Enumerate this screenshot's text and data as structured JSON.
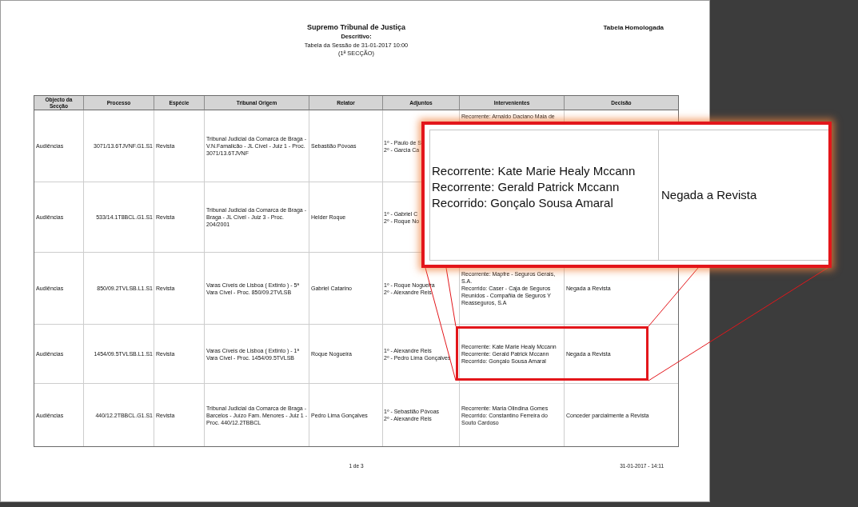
{
  "document": {
    "court": "Supremo Tribunal de Justiça",
    "heading": "Descritivo:",
    "session": "Tabela da Sessão de 31-01-2017 10:00",
    "section": "(1ª SECÇÃO)",
    "status": "Tabela Homologada"
  },
  "table": {
    "columns": [
      "Objecto da Secção",
      "Processo",
      "Espécie",
      "Tribunal Origem",
      "Relator",
      "Adjuntos",
      "Intervenientes",
      "Decisão"
    ],
    "rows": [
      {
        "objecto": "Audiências",
        "processo": "3071/13.6TJVNF.G1.S1",
        "especie": "Revista",
        "tribunal_origem": "Tribunal Judicial da Comarca de Braga - V.N.Famalicão - JL Cível - Juiz 1 - Proc. 3071/13.6TJVNF",
        "relator": "Sebastião Póvoas",
        "adjuntos": [
          "1º - Paulo de S",
          "2º - Garcia Ca"
        ],
        "intervenientes": [
          "Recorrente: Arnaldo Daciano Maia de"
        ],
        "highlighted": false
      },
      {
        "objecto": "Audiências",
        "processo": "533/14.1T8BCL.G1.S1",
        "especie": "Revista",
        "tribunal_origem": "Tribunal Judicial da Comarca de Braga - Braga - JL Cível - Juiz 3 - Proc. 204/2001",
        "relator": "Helder Roque",
        "adjuntos": [
          "1º - Gabriel C",
          "2º - Roque No"
        ],
        "highlighted": false
      },
      {
        "objecto": "Audiências",
        "processo": "850/09.2TVLSB.L1.S1",
        "especie": "Revista",
        "tribunal_origem": "Varas Cíveis de Lisboa ( Extinto ) - 5ª Vara Cível - Proc. 850/09.2TVLSB",
        "relator": "Gabriel Catarino",
        "adjuntos": [
          "1º - Roque Nogueira",
          "2º - Alexandre Reis"
        ],
        "intervenientes": [
          "Recorrente: Mapfre - Seguros Gerais, S.A.",
          "Recorrido: Caser - Caja de Seguros Reunidos - Compañia de Seguros Y Reasseguros, S.A"
        ],
        "decisao": "Negada a Revista",
        "highlighted": false
      },
      {
        "objecto": "Audiências",
        "processo": "1454/09.5TVLSB.L1.S1",
        "especie": "Revista",
        "tribunal_origem": "Varas Cíveis de Lisboa ( Extinto ) - 1ª Vara Cível - Proc. 1454/09.5TVLSB",
        "relator": "Roque Nogueira",
        "adjuntos": [
          "1º - Alexandre Reis",
          "2º - Pedro Lima Gonçalves"
        ],
        "intervenientes": [
          "Recorrente: Kate Marie Healy Mccann",
          "Recorrente: Gerald Patrick Mccann",
          "Recorrido: Gonçalo Sousa Amaral"
        ],
        "decisao": "Negada a Revista",
        "highlighted": true
      },
      {
        "objecto": "Audiências",
        "processo": "440/12.2TBBCL.G1.S1",
        "especie": "Revista",
        "tribunal_origem": "Tribunal Judicial da Comarca de Braga - Barcelos - Juízo Fam. Menores - Juiz 1 - Proc. 440/12.2TBBCL",
        "relator": "Pedro Lima Gonçalves",
        "adjuntos": [
          "1º - Sebastião Póvoas",
          "2º - Alexandre Reis"
        ],
        "intervenientes": [
          "Recorrente: Maria Olindina Gomes",
          "Recorrido: Constantino Ferreira do Souto Cardoso"
        ],
        "decisao": "Conceder parcialmente a Revista",
        "highlighted": false
      }
    ]
  },
  "footer": {
    "page": "1 de 3",
    "printed": "31-01-2017 - 14:11"
  },
  "callout": {
    "parties": [
      "Recorrente: Kate Marie Healy Mccann",
      "Recorrente: Gerald Patrick Mccann",
      "Recorrido: Gonçalo Sousa Amaral"
    ],
    "decision": "Negada a Revista"
  }
}
